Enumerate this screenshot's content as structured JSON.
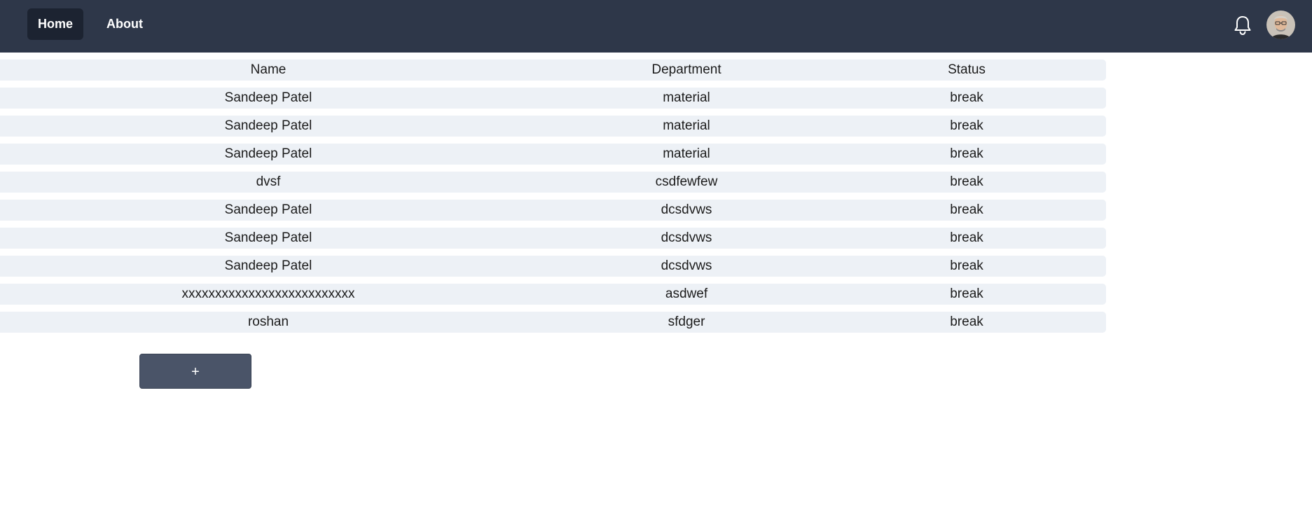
{
  "nav": {
    "items": [
      {
        "label": "Home",
        "active": true
      },
      {
        "label": "About",
        "active": false
      }
    ],
    "notification_icon": "bell-icon",
    "avatar_icon": "user-avatar"
  },
  "table": {
    "headers": {
      "name": "Name",
      "department": "Department",
      "status": "Status"
    },
    "rows": [
      {
        "name": "Sandeep Patel",
        "department": "material",
        "status": "break"
      },
      {
        "name": "Sandeep Patel",
        "department": "material",
        "status": "break"
      },
      {
        "name": "Sandeep Patel",
        "department": "material",
        "status": "break"
      },
      {
        "name": "dvsf",
        "department": "csdfewfew",
        "status": "break"
      },
      {
        "name": "Sandeep Patel",
        "department": "dcsdvws",
        "status": "break"
      },
      {
        "name": "Sandeep Patel",
        "department": "dcsdvws",
        "status": "break"
      },
      {
        "name": "Sandeep Patel",
        "department": "dcsdvws",
        "status": "break"
      },
      {
        "name": "xxxxxxxxxxxxxxxxxxxxxxxxxx",
        "department": "asdwef",
        "status": "break"
      },
      {
        "name": "roshan",
        "department": "sfdger",
        "status": "break"
      }
    ]
  },
  "actions": {
    "add_label": "+"
  },
  "colors": {
    "navbar_bg": "#2e3749",
    "active_nav_bg": "#1c2331",
    "row_bg": "#edf1f6",
    "add_button_bg": "#4a5468"
  }
}
